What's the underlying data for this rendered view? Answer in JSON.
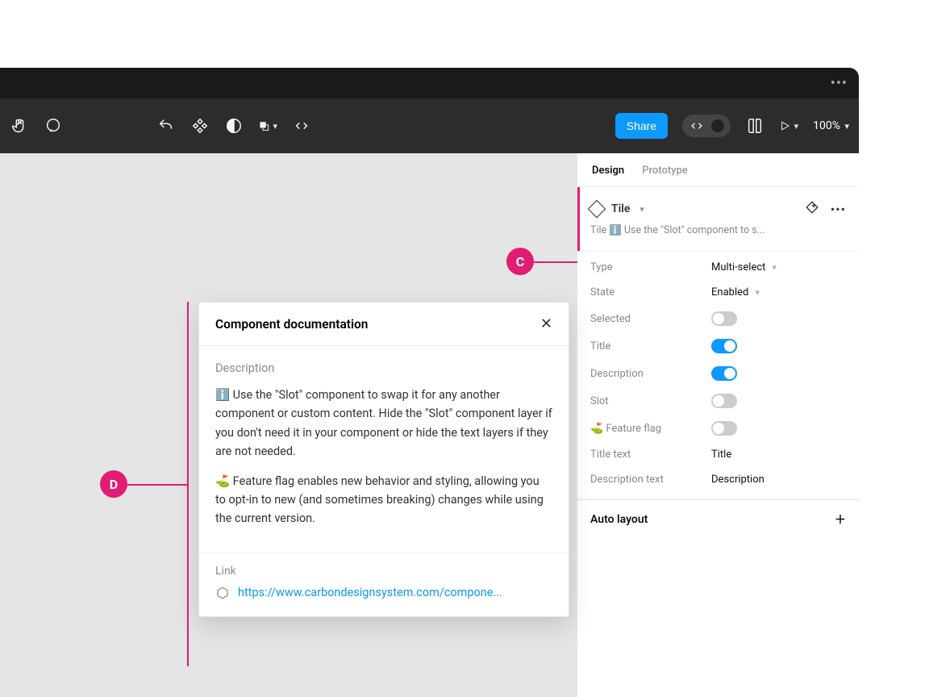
{
  "toolbar": {
    "share_label": "Share",
    "zoom": "100%"
  },
  "inspector": {
    "tabs": [
      "Design",
      "Prototype"
    ],
    "active_tab": 0,
    "component_name": "Tile",
    "component_desc": "Tile ℹ️ Use the \"Slot\" component to s...",
    "props": {
      "type": {
        "label": "Type",
        "value": "Multi-select"
      },
      "state": {
        "label": "State",
        "value": "Enabled"
      },
      "selected": {
        "label": "Selected",
        "on": false
      },
      "title_toggle": {
        "label": "Title",
        "on": true
      },
      "description_toggle": {
        "label": "Description",
        "on": true
      },
      "slot_toggle": {
        "label": "Slot",
        "on": false
      },
      "feature_flag": {
        "label": "⛳ Feature flag",
        "on": false
      },
      "title_text": {
        "label": "Title text",
        "value": "Title"
      },
      "description_text": {
        "label": "Description text",
        "value": "Description"
      }
    },
    "auto_layout_label": "Auto layout"
  },
  "doc": {
    "title": "Component documentation",
    "desc_label": "Description",
    "desc_p1": "ℹ️ Use the \"Slot\" component to swap it for any another component or custom content. Hide the \"Slot\" component layer if you don't need it in your component or hide the text layers if they are not needed.",
    "desc_p2": "⛳ Feature flag enables new behavior and styling, allowing you to opt-in to new (and sometimes breaking) changes while using the current version.",
    "link_label": "Link",
    "link_text": "https://www.carbondesignsystem.com/compone..."
  },
  "annotations": {
    "c": "C",
    "d": "D"
  },
  "colors": {
    "accent": "#0D99FF",
    "pink": "#e11d73"
  }
}
